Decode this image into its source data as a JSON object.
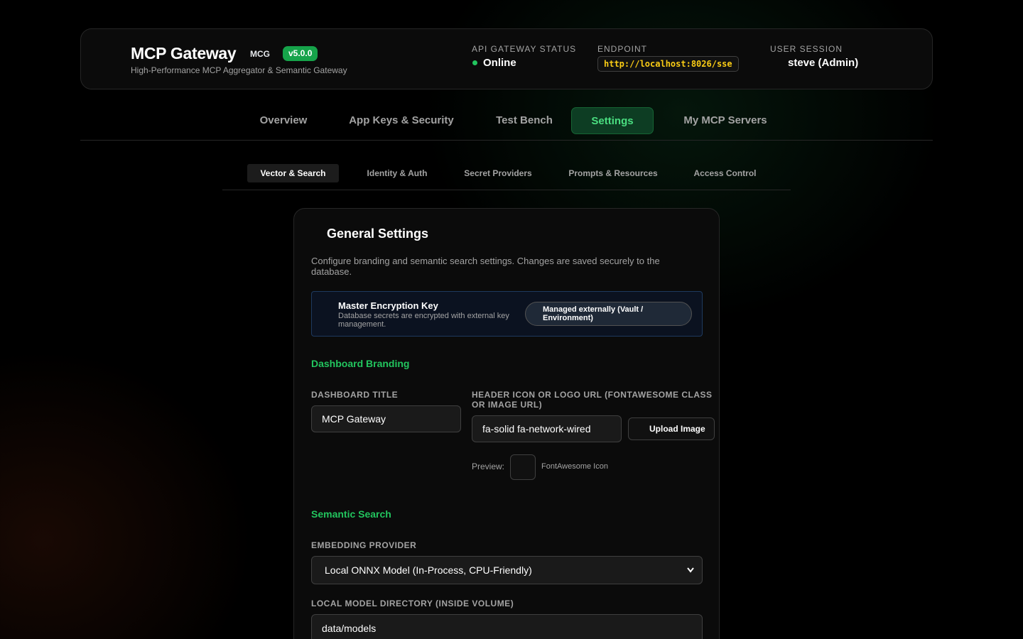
{
  "header": {
    "title": "MCP Gateway",
    "short_name": "MCG",
    "version": "v5.0.0",
    "subtitle": "High-Performance MCP Aggregator & Semantic Gateway",
    "status_label": "API GATEWAY STATUS",
    "status_value": "Online",
    "endpoint_label": "ENDPOINT",
    "endpoint_value": "http://localhost:8026/sse",
    "session_label": "USER SESSION",
    "session_value": "steve (Admin)"
  },
  "main_tabs": {
    "items": [
      {
        "label": "Overview"
      },
      {
        "label": "App Keys & Security"
      },
      {
        "label": "Test Bench"
      },
      {
        "label": "Settings"
      },
      {
        "label": "My MCP Servers"
      }
    ],
    "active": "Settings"
  },
  "sub_tabs": {
    "items": [
      {
        "label": "Vector & Search"
      },
      {
        "label": "Identity & Auth"
      },
      {
        "label": "Secret Providers"
      },
      {
        "label": "Prompts & Resources"
      },
      {
        "label": "Access Control"
      }
    ],
    "active": "Vector & Search"
  },
  "settings": {
    "title": "General Settings",
    "description": "Configure branding and semantic search settings. Changes are saved securely to the database.",
    "master_key": {
      "title": "Master Encryption Key",
      "description": "Database secrets are encrypted with external key management.",
      "badge": "Managed externally (Vault / Environment)"
    },
    "branding": {
      "section_title": "Dashboard Branding",
      "dashboard_title_label": "DASHBOARD TITLE",
      "dashboard_title_value": "MCP Gateway",
      "icon_label": "HEADER ICON OR LOGO URL (FONTAWESOME CLASS OR IMAGE URL)",
      "icon_value": "fa-solid fa-network-wired",
      "upload_button": "Upload Image",
      "preview_label": "Preview:",
      "preview_note": "FontAwesome Icon"
    },
    "semantic_search": {
      "section_title": "Semantic Search",
      "provider_label": "EMBEDDING PROVIDER",
      "provider_value": "Local ONNX Model (In-Process, CPU-Friendly)",
      "model_dir_label": "LOCAL MODEL DIRECTORY (INSIDE VOLUME)",
      "model_dir_value": "data/models"
    }
  },
  "colors": {
    "accent": "#22c55e",
    "version_badge": "#16a34a",
    "endpoint_text": "#facc15",
    "background": "#000000"
  }
}
